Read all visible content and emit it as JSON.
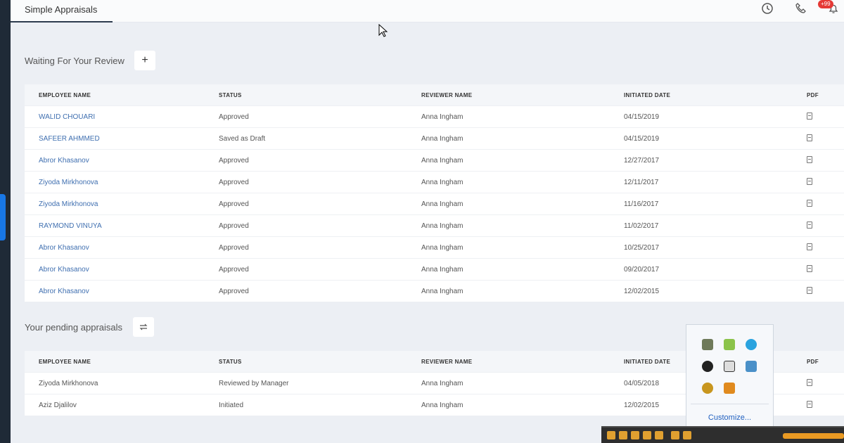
{
  "tab": {
    "label": "Simple Appraisals"
  },
  "header": {
    "notification_badge": "+99"
  },
  "waiting": {
    "title": "Waiting For Your Review",
    "add_button": "+",
    "columns": [
      "EMPLOYEE NAME",
      "STATUS",
      "REVIEWER NAME",
      "INITIATED DATE",
      "PDF"
    ],
    "rows": [
      {
        "name": "WALID CHOUARI",
        "status": "Approved",
        "reviewer": "Anna Ingham",
        "date": "04/15/2019"
      },
      {
        "name": "SAFEER AHMMED",
        "status": "Saved as Draft",
        "reviewer": "Anna Ingham",
        "date": "04/15/2019"
      },
      {
        "name": "Abror Khasanov",
        "status": "Approved",
        "reviewer": "Anna Ingham",
        "date": "12/27/2017"
      },
      {
        "name": "Ziyoda Mirkhonova",
        "status": "Approved",
        "reviewer": "Anna Ingham",
        "date": "12/11/2017"
      },
      {
        "name": "Ziyoda Mirkhonova",
        "status": "Approved",
        "reviewer": "Anna Ingham",
        "date": "11/16/2017"
      },
      {
        "name": "RAYMOND VINUYA",
        "status": "Approved",
        "reviewer": "Anna Ingham",
        "date": "11/02/2017"
      },
      {
        "name": "Abror Khasanov",
        "status": "Approved",
        "reviewer": "Anna Ingham",
        "date": "10/25/2017"
      },
      {
        "name": "Abror Khasanov",
        "status": "Approved",
        "reviewer": "Anna Ingham",
        "date": "09/20/2017"
      },
      {
        "name": "Abror Khasanov",
        "status": "Approved",
        "reviewer": "Anna Ingham",
        "date": "12/02/2015"
      }
    ]
  },
  "pending": {
    "title": "Your pending appraisals",
    "columns": [
      "EMPLOYEE NAME",
      "STATUS",
      "REVIEWER NAME",
      "INITIATED DATE",
      "PDF"
    ],
    "rows": [
      {
        "name": "Ziyoda Mirkhonova",
        "status": "Reviewed by Manager",
        "reviewer": "Anna Ingham",
        "date": "04/05/2018"
      },
      {
        "name": "Aziz Djalilov",
        "status": "Initiated",
        "reviewer": "Anna Ingham",
        "date": "12/02/2015"
      }
    ]
  },
  "tray": {
    "customize_label": "Customize..."
  },
  "icons": {
    "history": "clock-icon",
    "phone": "phone-icon",
    "bell": "bell-icon",
    "pdf": "pdf-icon",
    "refresh": "refresh-icon"
  },
  "colors": {
    "accent": "#1877e6",
    "link": "#3f6fb0",
    "badge": "#e53935"
  }
}
